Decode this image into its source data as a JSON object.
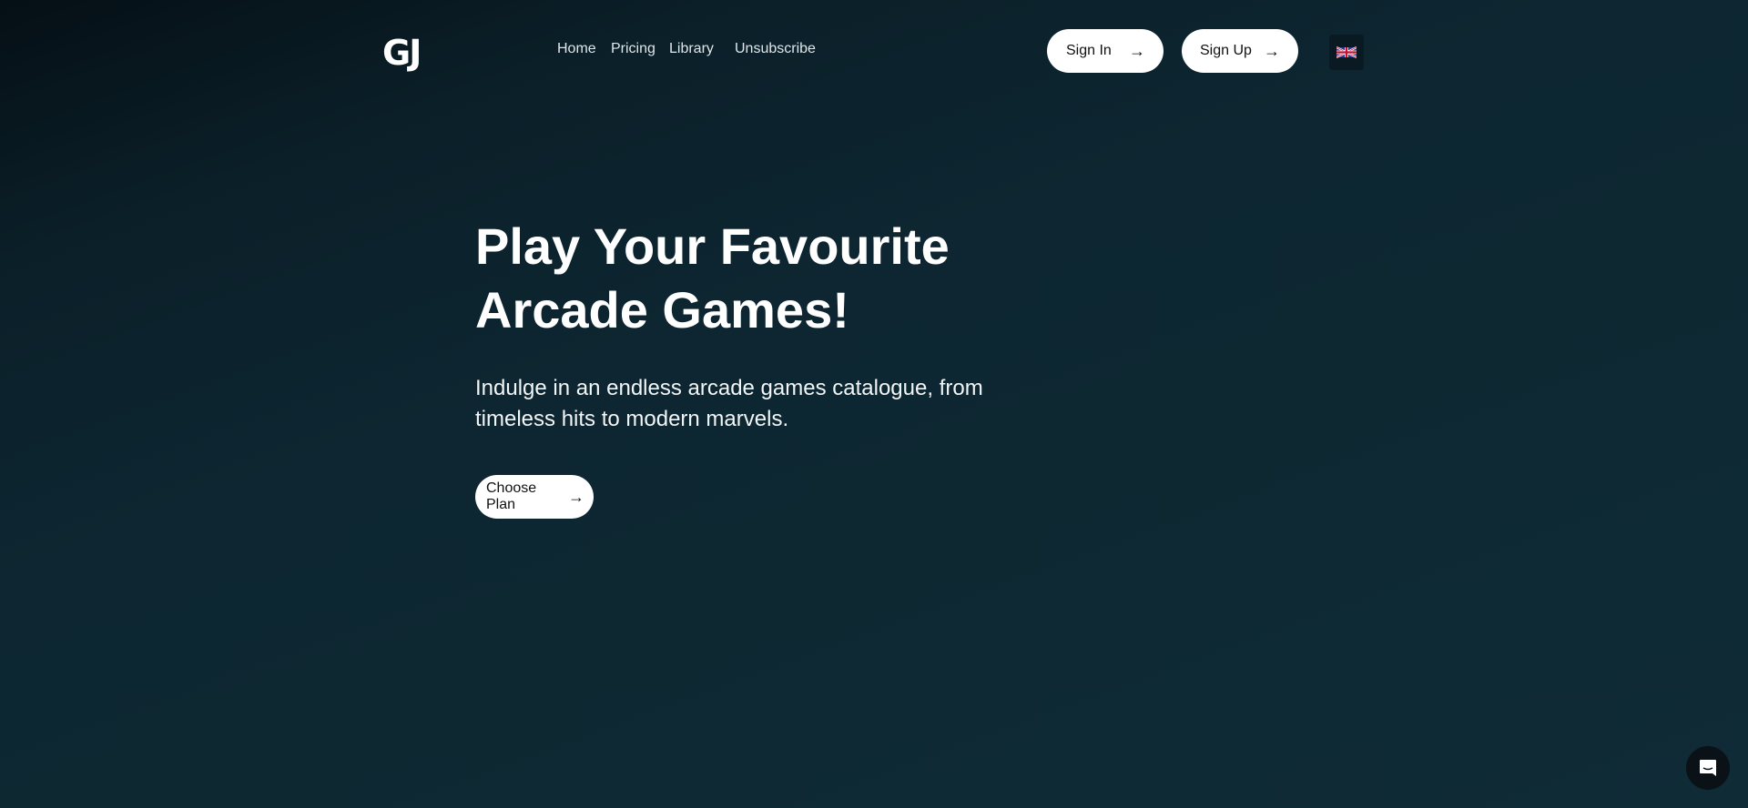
{
  "header": {
    "logo": "GJ",
    "nav": [
      {
        "label": "Home"
      },
      {
        "label": "Pricing"
      },
      {
        "label": "Library"
      },
      {
        "label": "Unsubscribe"
      }
    ],
    "sign_in": "Sign In",
    "sign_up": "Sign Up",
    "language_icon": "uk-flag-icon"
  },
  "hero": {
    "title": "Play Your Favourite Arcade Games!",
    "subtitle": "Indulge in an endless arcade games catalogue, from timeless hits to modern marvels.",
    "cta": "Choose Plan"
  },
  "chat_icon": "chat-icon",
  "colors": {
    "background": "#0e2933",
    "button": "#ffffff"
  }
}
